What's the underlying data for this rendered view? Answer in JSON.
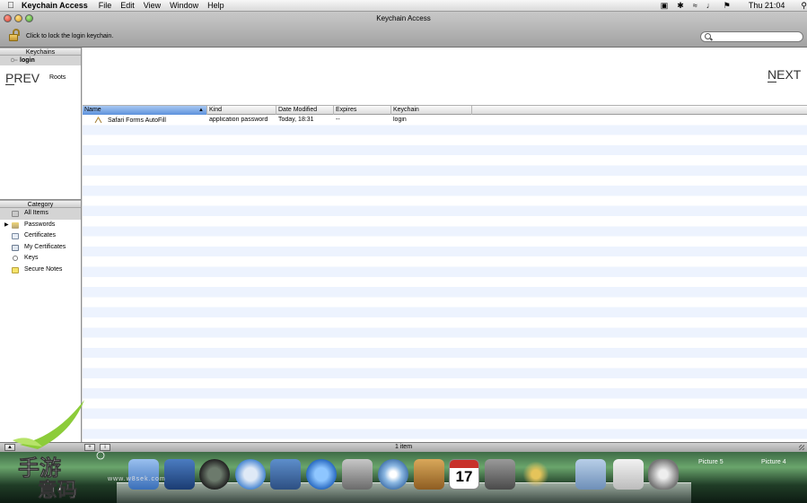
{
  "menubar": {
    "app_name": "Keychain Access",
    "menus": [
      "File",
      "Edit",
      "View",
      "Window",
      "Help"
    ],
    "clock": "Thu 21:04"
  },
  "window": {
    "title": "Keychain Access",
    "lock_hint": "Click to lock the login keychain.",
    "search_placeholder": ""
  },
  "keychains": {
    "header": "Keychains",
    "items": [
      {
        "label": "login",
        "selected": true
      },
      {
        "label": "Roots",
        "selected": false
      }
    ]
  },
  "category": {
    "header": "Category",
    "items": [
      {
        "label": "All Items",
        "icon": "all-items-icon",
        "selected": true
      },
      {
        "label": "Passwords",
        "icon": "passwords-icon",
        "selected": false,
        "expandable": true
      },
      {
        "label": "Certificates",
        "icon": "certificate-icon",
        "selected": false
      },
      {
        "label": "My Certificates",
        "icon": "my-certificate-icon",
        "selected": false
      },
      {
        "label": "Keys",
        "icon": "key-icon",
        "selected": false
      },
      {
        "label": "Secure Notes",
        "icon": "secure-note-icon",
        "selected": false
      }
    ]
  },
  "table": {
    "columns": [
      "Name",
      "Kind",
      "Date Modified",
      "Expires",
      "Keychain"
    ],
    "sorted_column": "Name",
    "rows": [
      {
        "name": "Safari Forms AutoFill",
        "kind": "application password",
        "date_modified": "Today, 18:31",
        "expires": "--",
        "keychain": "login"
      }
    ]
  },
  "status": {
    "count_text": "1 item"
  },
  "overlay": {
    "prev": "PREV",
    "next": "NEXT"
  },
  "dock": {
    "labels": [
      "Picture 5",
      "Picture 4"
    ],
    "calendar_day": "17",
    "watermark_site": "www.w8sek.com"
  }
}
